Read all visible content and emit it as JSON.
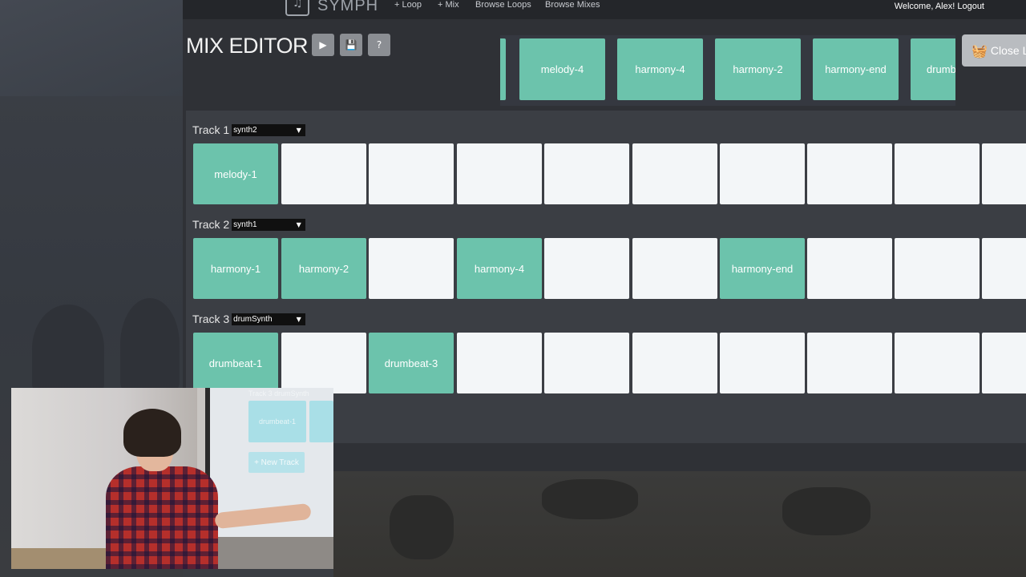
{
  "navbar": {
    "brand": "SYMPH",
    "links": [
      "+ Loop",
      "+ Mix",
      "Browse Loops",
      "Browse Mixes"
    ],
    "welcome": "Welcome, Alex! Logout"
  },
  "editor": {
    "title": "MIX EDITOR",
    "toolbar": {
      "play_icon": "play-icon",
      "save_icon": "save-icon",
      "help_icon": "help-icon"
    }
  },
  "palette": {
    "loops": [
      "melody-4",
      "harmony-4",
      "harmony-2",
      "harmony-end",
      "drumb"
    ],
    "close_label": "Close Lo",
    "close_icon": "basket-icon"
  },
  "tracks": [
    {
      "label": "Track 1",
      "synth": "synth2",
      "cells": [
        "melody-1",
        "",
        "",
        "",
        "",
        "",
        "",
        "",
        "",
        ""
      ]
    },
    {
      "label": "Track 2",
      "synth": "synth1",
      "cells": [
        "harmony-1",
        "harmony-2",
        "",
        "harmony-4",
        "",
        "",
        "harmony-end",
        "",
        "",
        ""
      ]
    },
    {
      "label": "Track 3",
      "synth": "drumSynth",
      "cells": [
        "drumbeat-1",
        "",
        "drumbeat-3",
        "",
        "",
        "",
        "",
        "",
        "",
        ""
      ]
    }
  ],
  "webcam": {
    "mini_track_label": "Track 3 drumSynth",
    "mini_cell_label": "drumbeat-1",
    "mini_new_track": "+ New Track"
  },
  "colors": {
    "loop_filled": "#6cc3ac",
    "loop_empty": "#f3f6f8",
    "panel": "#3b3e44",
    "navbar": "#24262a"
  }
}
